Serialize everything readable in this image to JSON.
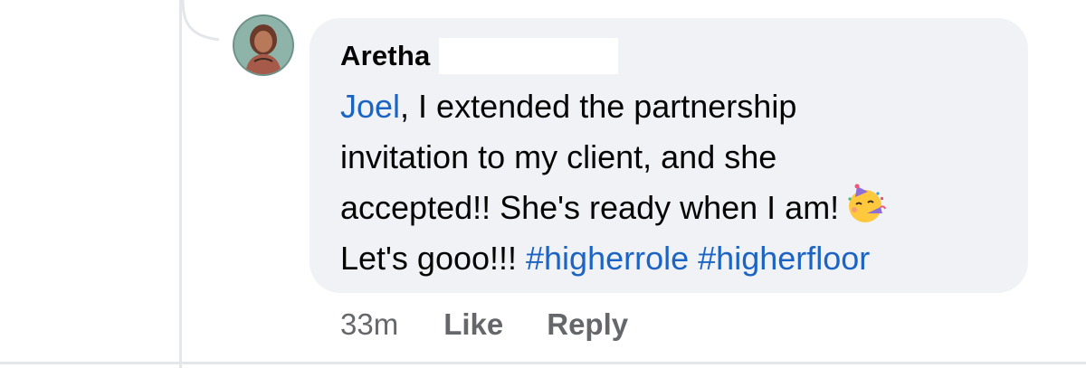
{
  "comment": {
    "author": "Aretha",
    "mention": "Joel",
    "lines": [
      ", I extended the partnership",
      "invitation to my client, and she",
      "accepted!! She's ready when I am!",
      "Let's gooo!!! "
    ],
    "hashtags": [
      "#higherrole",
      "#higherfloor"
    ],
    "emoji": "partying-face"
  },
  "actions": {
    "timestamp": "33m",
    "like_label": "Like",
    "reply_label": "Reply"
  },
  "colors": {
    "bubble": "#f0f2f5",
    "link": "#1b64c4",
    "meta": "#65676b"
  }
}
